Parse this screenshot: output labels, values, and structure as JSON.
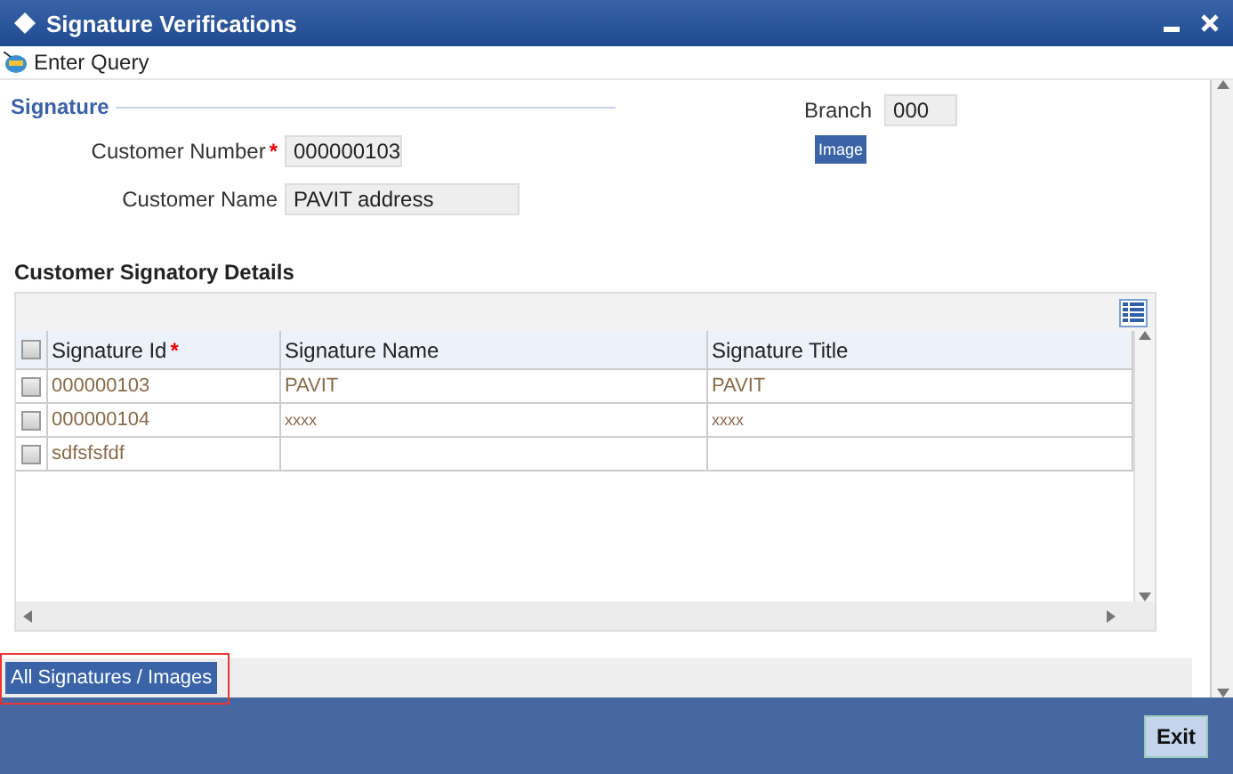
{
  "window": {
    "title": "Signature Verifications"
  },
  "toolbar": {
    "label": "Enter Query"
  },
  "signature": {
    "legend": "Signature",
    "customer_number": {
      "label": "Customer Number",
      "required_mark": "*",
      "value": "000000103"
    },
    "customer_name": {
      "label": "Customer Name",
      "value": "PAVIT address"
    },
    "branch": {
      "label": "Branch",
      "value": "000"
    },
    "image_button": "Image"
  },
  "table": {
    "title": "Customer Signatory Details",
    "header_checked": false,
    "columns": [
      {
        "label": "Signature Id",
        "required_mark": "*"
      },
      {
        "label": "Signature Name"
      },
      {
        "label": "Signature Title"
      }
    ],
    "rows": [
      {
        "checked": false,
        "cells": [
          "000000103",
          "PAVIT",
          "PAVIT"
        ]
      },
      {
        "checked": false,
        "cells": [
          "000000104",
          "xxxx",
          "xxxx"
        ]
      },
      {
        "checked": false,
        "cells": [
          "sdfsfsfdf",
          "",
          ""
        ]
      }
    ]
  },
  "bottom_button": {
    "label": "All Signatures / Images",
    "highlighted": true
  },
  "footer": {
    "exit": "Exit"
  }
}
